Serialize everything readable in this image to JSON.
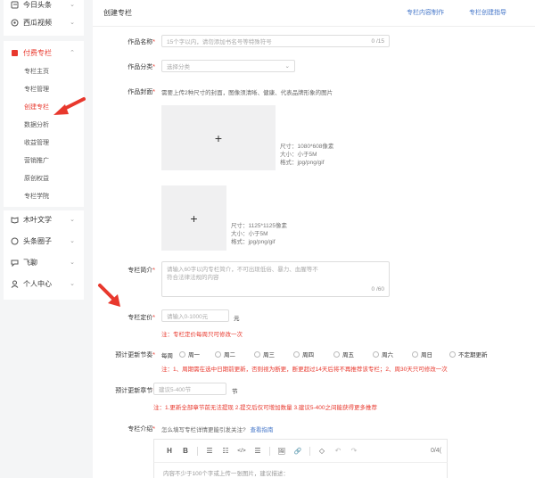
{
  "sidebar": {
    "top_items": [
      {
        "label": "今日头条",
        "icon": "headline-icon"
      },
      {
        "label": "西瓜视频",
        "icon": "watermelon-video-icon"
      }
    ],
    "pay_column": {
      "label": "付费专栏",
      "icon": "book-icon",
      "items": [
        "专栏主页",
        "专栏管理",
        "创建专栏",
        "数据分析",
        "收益管理",
        "营销推广",
        "原创权益",
        "专栏学院"
      ],
      "active": "创建专栏"
    },
    "bottom_items": [
      {
        "label": "木叶文学",
        "icon": "book-open-icon"
      },
      {
        "label": "头条圈子",
        "icon": "circle-icon"
      },
      {
        "label": "飞聊",
        "icon": "chat-icon"
      },
      {
        "label": "个人中心",
        "icon": "user-icon"
      }
    ],
    "accent_color": "#e8382d"
  },
  "header": {
    "title": "创建专栏",
    "links": [
      "专栏内容制作",
      "专栏创建指导"
    ]
  },
  "form": {
    "name": {
      "label": "作品名称",
      "placeholder": "15个字以内，请勿添加书名号等特殊符号",
      "counter": "0 /15"
    },
    "category": {
      "label": "作品分类",
      "placeholder": "选择分类"
    },
    "cover": {
      "label": "作品封面",
      "hint": "需要上传2种尺寸的封面，图像须清晰、健康、代表品牌形象的图片",
      "upload_plus": "+",
      "spec_large": [
        "尺寸：1080*608像素",
        "大小：小于5M",
        "格式：jpg/png/gif"
      ],
      "spec_square": [
        "尺寸：1125*1125像素",
        "大小：小于5M",
        "格式：jpg/png/gif"
      ]
    },
    "intro": {
      "label": "专栏简介",
      "placeholder": "请输入60字以内专栏简介，不可出现低俗、暴力、血腥等不符合法律法规的内容",
      "counter": "0 /60"
    },
    "price": {
      "label": "专栏定价",
      "placeholder": "请输入0-1000元",
      "unit": "元",
      "note": "注：专栏定价每周只可修改一次"
    },
    "update_schedule": {
      "label": "预计更新节奏",
      "prefix": "每周",
      "days": [
        "周一",
        "周二",
        "周三",
        "周四",
        "周五",
        "周六",
        "周日",
        "不定期更新"
      ],
      "note": "注：1、周期需在选中日期前更新，否则视为断更，断更超过14天后将不再推荐该专栏；2、周30天只可修改一次"
    },
    "chapters": {
      "label": "预计更新章节",
      "placeholder": "建议5-400节",
      "unit": "节",
      "note": "注：1.更新全部章节前无法提现  2.提交后仅可增加数量  3.建议5-400之间能获得更多推荐"
    },
    "description": {
      "label": "专栏介绍",
      "hint": "怎么填写专栏详情更能引发关注?",
      "hint_link": "查看指南",
      "toolbar": [
        "H",
        "B",
        "☰",
        "☷",
        "</>",
        "☰",
        "🖼",
        "🔗",
        "◇",
        "↶",
        "↷"
      ],
      "counter": "0/4(",
      "placeholder": "内容不少于100个字或上传一张图片，建议描述："
    }
  }
}
